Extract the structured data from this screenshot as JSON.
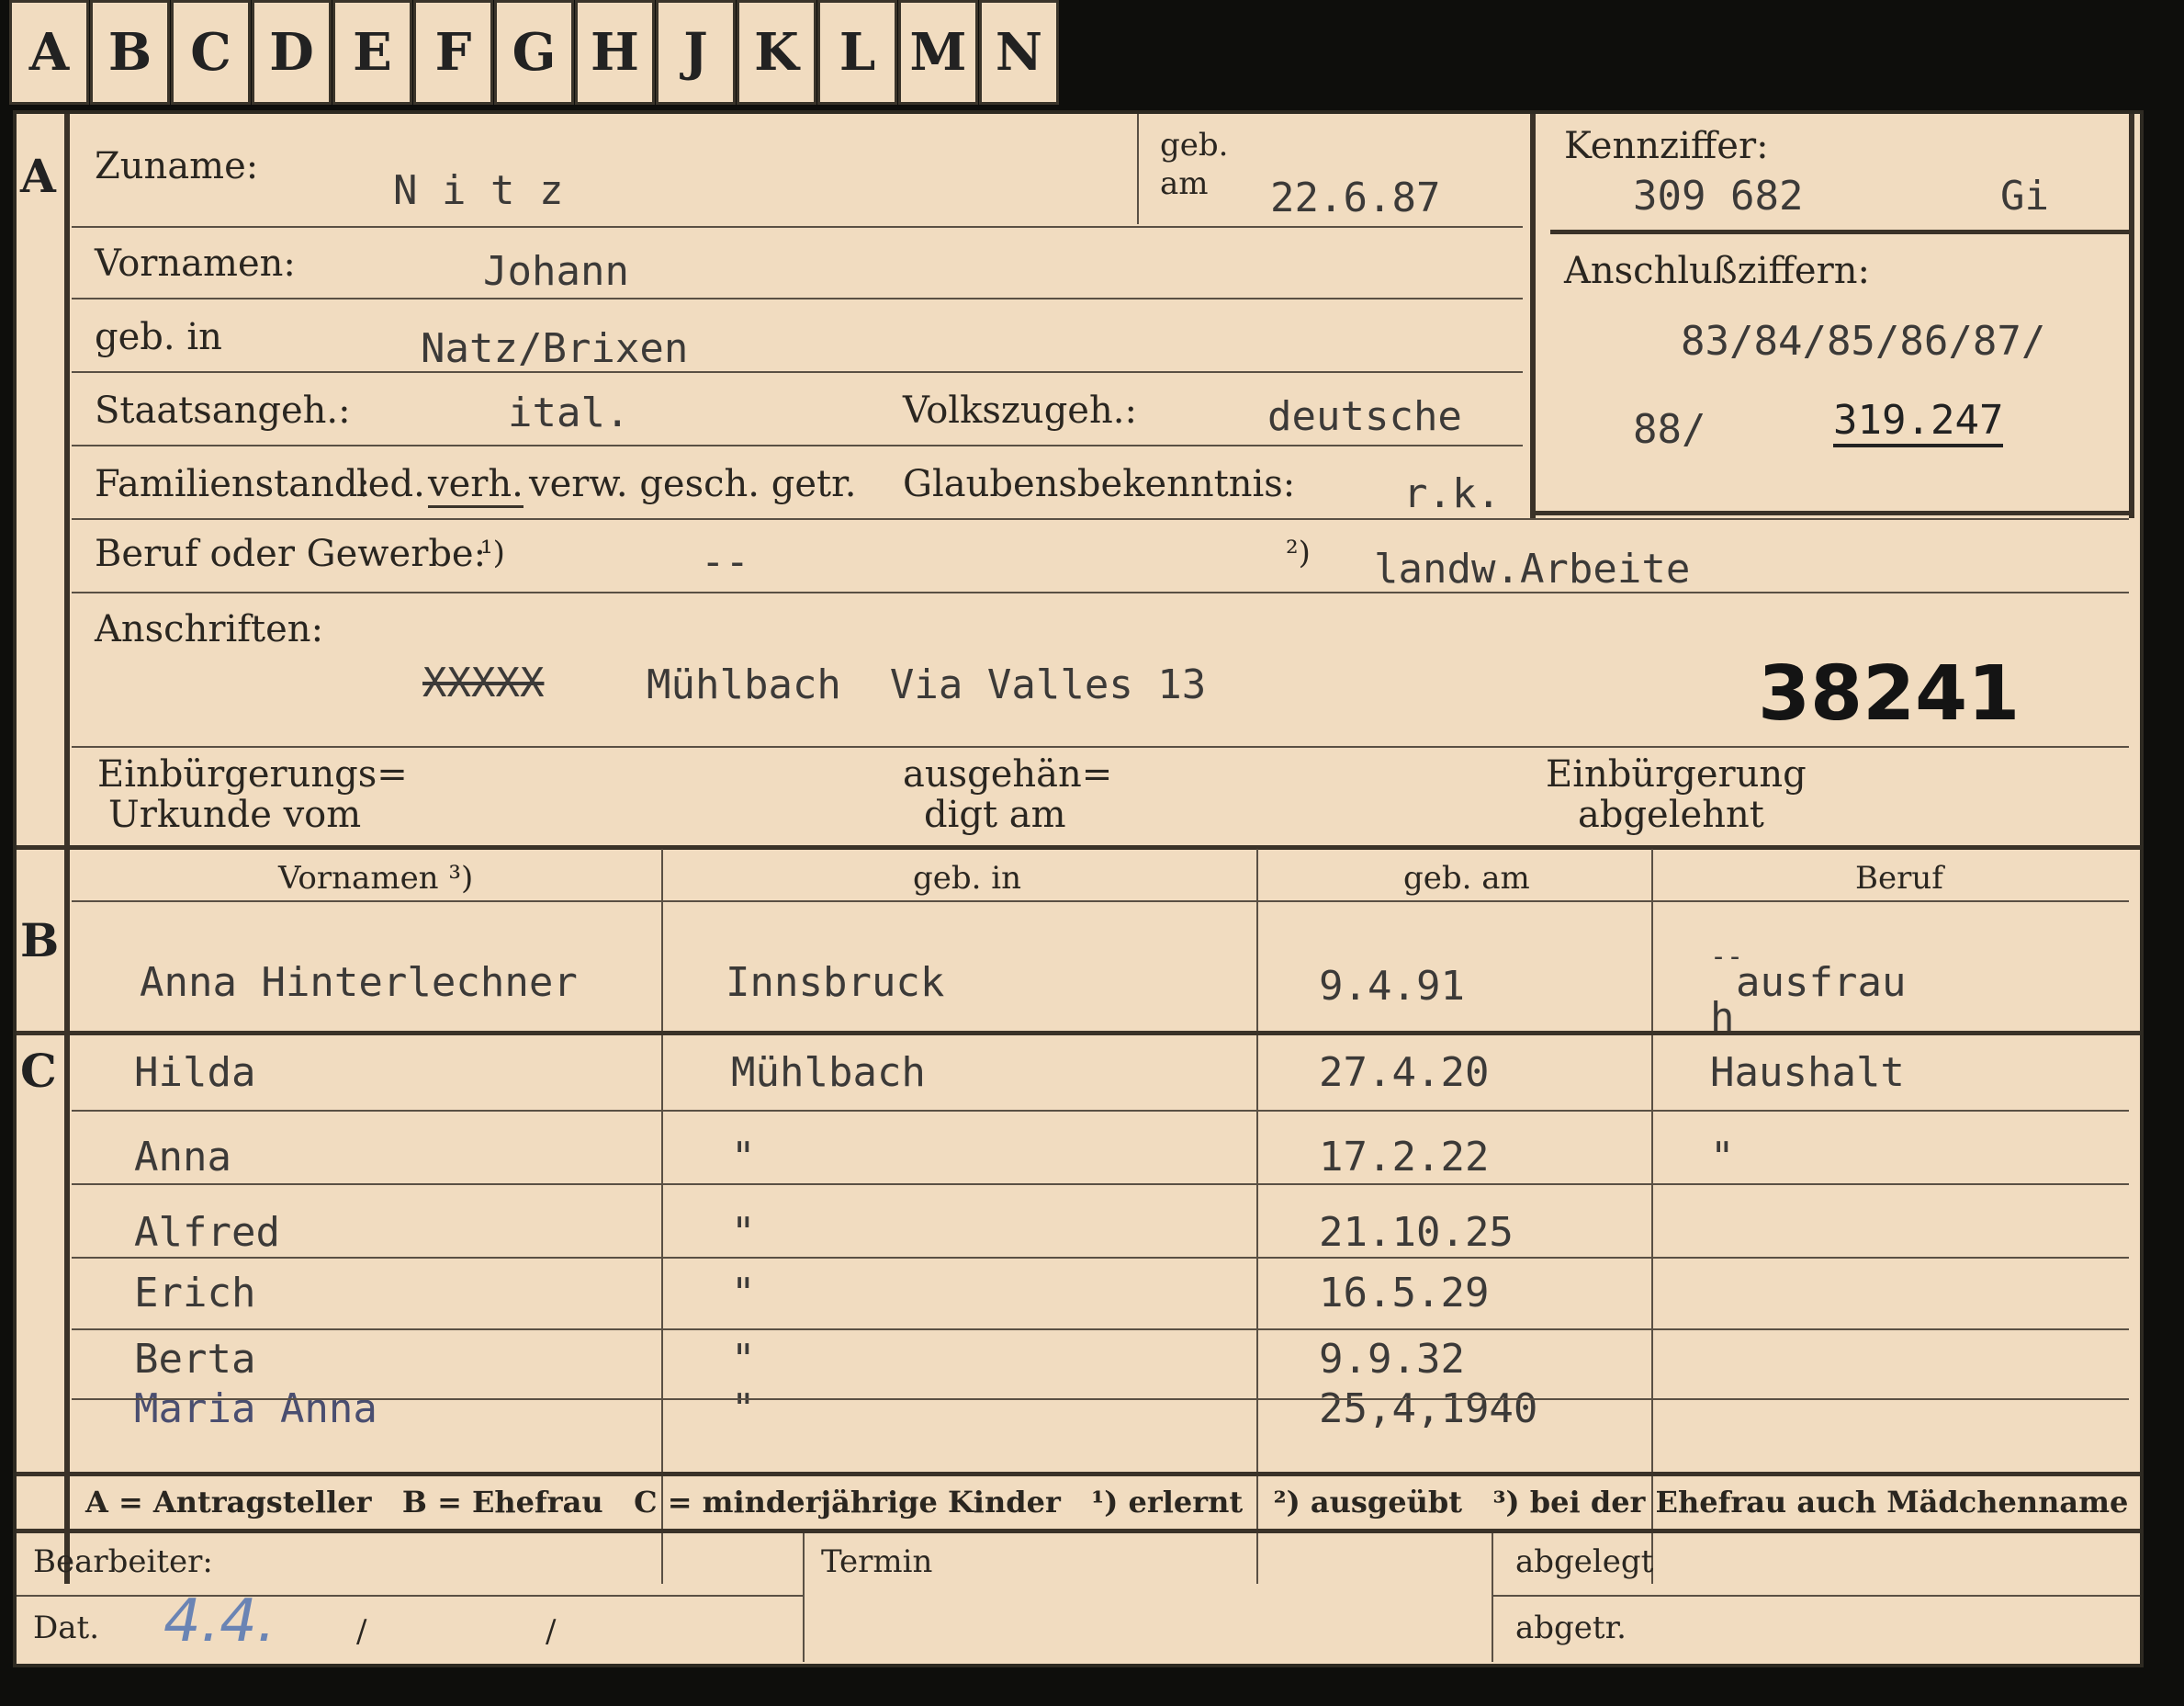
{
  "tabs": [
    "A",
    "B",
    "C",
    "D",
    "E",
    "F",
    "G",
    "H",
    "J",
    "K",
    "L",
    "M",
    "N"
  ],
  "section_marks": {
    "a": "A",
    "b": "B",
    "c": "C"
  },
  "labels": {
    "zuname": "Zuname:",
    "geb_am_1": "geb.",
    "geb_am_2": "am",
    "kennziffer": "Kennziffer:",
    "vornamen": "Vornamen:",
    "anschlussziffern": "Anschlußziffern:",
    "geb_in": "geb. in",
    "staatsangeh": "Staatsangeh.:",
    "volkszugeh": "Volkszugeh.:",
    "familienstand": "Familienstand:",
    "fs_led": "led.",
    "fs_verh": "verh.",
    "fs_rest": "verw. gesch. getr.",
    "glaubensbekenntnis": "Glaubensbekenntnis:",
    "beruf": "Beruf oder Gewerbe:",
    "fn1": "¹)",
    "fn2": "²)",
    "anschriften": "Anschriften:",
    "einb_urk_1": "Einbürgerungs=",
    "einb_urk_2": "Urkunde vom",
    "ausgeh_1": "ausgehän=",
    "ausgeh_2": "digt am",
    "einb_abg_1": "Einbürgerung",
    "einb_abg_2": "abgelehnt"
  },
  "applicant": {
    "surname": "N i t z",
    "birth_date": "22.6.87",
    "kennziffer": "309 682",
    "kennziffer_suffix": "Gi",
    "first_names": "Johann",
    "birthplace": "Natz/Brixen",
    "anschluss_line1": "83/84/85/86/87/",
    "anschluss_line2a": "88/",
    "anschluss_line2b": "319.247",
    "citizenship": "ital.",
    "ethnicity": "deutsche",
    "religion": "r.k.",
    "profession_learned": "--",
    "profession_practiced": "landw.Arbeite",
    "address_struck": "XXXXX",
    "address": "Mühlbach  Via Valles 13",
    "stamp_number": "38241"
  },
  "table_headers": {
    "vornamen": "Vornamen ³)",
    "geb_in": "geb. in",
    "geb_am": "geb. am",
    "beruf": "Beruf"
  },
  "wife": {
    "name": "Anna Hinterlechner",
    "birthplace": "Innsbruck",
    "birth_date": "9.4.91",
    "occupation": "ausfrau",
    "occupation_prefix": "h",
    "occupation_dash": "--"
  },
  "children": [
    {
      "name": "Hilda",
      "birthplace": "Mühlbach",
      "birth_date": "27.4.20",
      "occupation": "Haushalt"
    },
    {
      "name": "Anna",
      "birthplace": "\"",
      "birth_date": "17.2.22",
      "occupation": "\""
    },
    {
      "name": "Alfred",
      "birthplace": "\"",
      "birth_date": "21.10.25",
      "occupation": ""
    },
    {
      "name": "Erich",
      "birthplace": "\"",
      "birth_date": "16.5.29",
      "occupation": ""
    },
    {
      "name": "Berta",
      "birthplace": "\"",
      "birth_date": "9.9.32",
      "occupation": ""
    },
    {
      "name": "Maria Anna",
      "birthplace": "\"",
      "birth_date": "25,4,1940",
      "occupation": ""
    }
  ],
  "legend": "A = Antragsteller   B = Ehefrau   C = minderjährige Kinder   ¹) erlernt   ²) ausgeübt   ³) bei der Ehefrau auch Mädchenname",
  "footer": {
    "bearbeiter": "Bearbeiter:",
    "termin": "Termin",
    "abgelegt": "abgelegt",
    "dat": "Dat.",
    "dat_value": "4.4.",
    "dat_sep1": "/",
    "dat_sep2": "/",
    "abgetr": "abgetr."
  }
}
